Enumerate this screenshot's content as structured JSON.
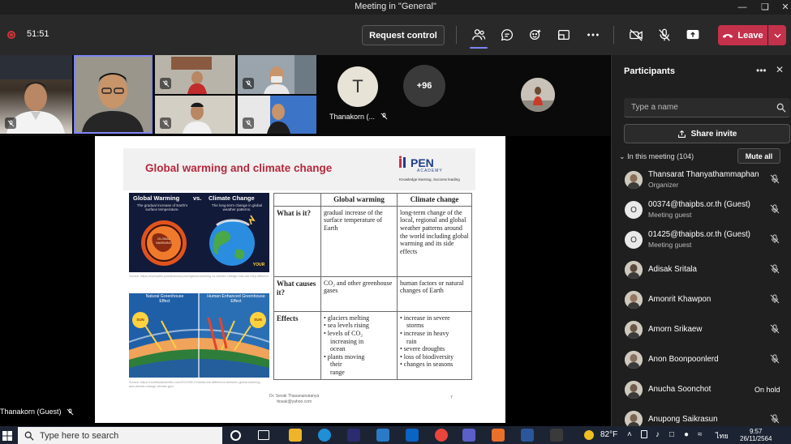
{
  "window": {
    "title": "Meeting in \"General\""
  },
  "toolbar": {
    "timer": "51:51",
    "request_control": "Request control",
    "leave": "Leave"
  },
  "strip": {
    "tile_name": "Thanakorn (...",
    "tile_initial": "T",
    "more_count": "+96"
  },
  "slide": {
    "title": "Global warming and climate change",
    "logo_text": "PEN",
    "logo_sub": "ACADEMY",
    "logo_tagline": "Knowledge learning, Success leading",
    "image1": {
      "left_heading": "Global Warming",
      "vs": "vs.",
      "right_heading": "Climate Change",
      "left_sub": "The gradual increase of Earth's surface temperature.",
      "right_sub": "The long-term change in global weather patterns.",
      "left_badge": "GLOBAL WARMING",
      "brand": "YOUR"
    },
    "caption1": "Source: https://examples.yourdictionary.com/global-warming-vs-climate-change-how-are-they-different",
    "image2": {
      "left_label": "Natural Greenhouse Effect",
      "right_label": "Human Enhanced Greenhouse Effect",
      "sun": "SUN"
    },
    "caption2": "Source: https://unofficialscientific.com/2019/05/17/whats-the-difference-between-global-warming-and-climate-change-climate-gov/",
    "table": {
      "headers": [
        "",
        "Global warming",
        "Climate change"
      ],
      "rows": [
        {
          "label": "What is it?",
          "gw": "gradual increase of the surface temperature of Earth",
          "cc": "long-term change of the local, regional and global weather patterns around the world including global warming and its side effects"
        },
        {
          "label": "What causes it?",
          "gw": "CO₂ and other greenhouse gases",
          "cc": "human factors or natural changes of Earth"
        }
      ],
      "effects_label": "Effects",
      "effects_gw": [
        "• glaciers melting",
        "• sea levels rising",
        "• levels of CO₂",
        "  increasing in",
        "  ocean",
        "• plants moving",
        "  their",
        "  range"
      ],
      "effects_cc": [
        "• increase in severe",
        "  storms",
        "• increase in heavy",
        "  rain",
        "• severe droughts",
        "• loss of biodiversity",
        "• changes in seasons"
      ]
    },
    "author_name": "Dr. Sevak Thasanainatanya",
    "author_email": "ttosak@yahoo.com",
    "page_number": "7"
  },
  "presenter": {
    "name": "Thanakorn (Guest)"
  },
  "participants": {
    "title": "Participants",
    "search_placeholder": "Type a name",
    "share_invite": "Share invite",
    "in_meeting": "In this meeting (104)",
    "mute_all": "Mute all",
    "list": [
      {
        "name": "Thansarat Thanyathammaphan",
        "role": "Organizer",
        "avatar": "photo",
        "status": "muted"
      },
      {
        "name": "00374@thaipbs.or.th (Guest)",
        "role": "Meeting guest",
        "avatar": "O",
        "status": "muted"
      },
      {
        "name": "01425@thaipbs.or.th (Guest)",
        "role": "Meeting guest",
        "avatar": "O",
        "status": "muted"
      },
      {
        "name": "Adisak Sritala",
        "role": "",
        "avatar": "photo",
        "status": "muted"
      },
      {
        "name": "Amonrit Khawpon",
        "role": "",
        "avatar": "photo",
        "status": "muted"
      },
      {
        "name": "Amorn Srikaew",
        "role": "",
        "avatar": "photo",
        "status": "muted"
      },
      {
        "name": "Anon Boonpoonlerd",
        "role": "",
        "avatar": "photo",
        "status": "muted"
      },
      {
        "name": "Anucha Soonchot",
        "role": "",
        "avatar": "photo",
        "status": "On hold"
      },
      {
        "name": "Anupong Saikrasun",
        "role": "",
        "avatar": "photo",
        "status": "muted"
      }
    ]
  },
  "taskbar": {
    "search_placeholder": "Type here to search",
    "weather": "82°F",
    "lang": "ไทย",
    "time": "9:57",
    "date": "26/11/2564"
  },
  "colors": {
    "leave_red": "#c4314b",
    "accent": "#7f85f5",
    "slide_title": "#b5283d",
    "panel_bg": "#1f1f1f"
  }
}
